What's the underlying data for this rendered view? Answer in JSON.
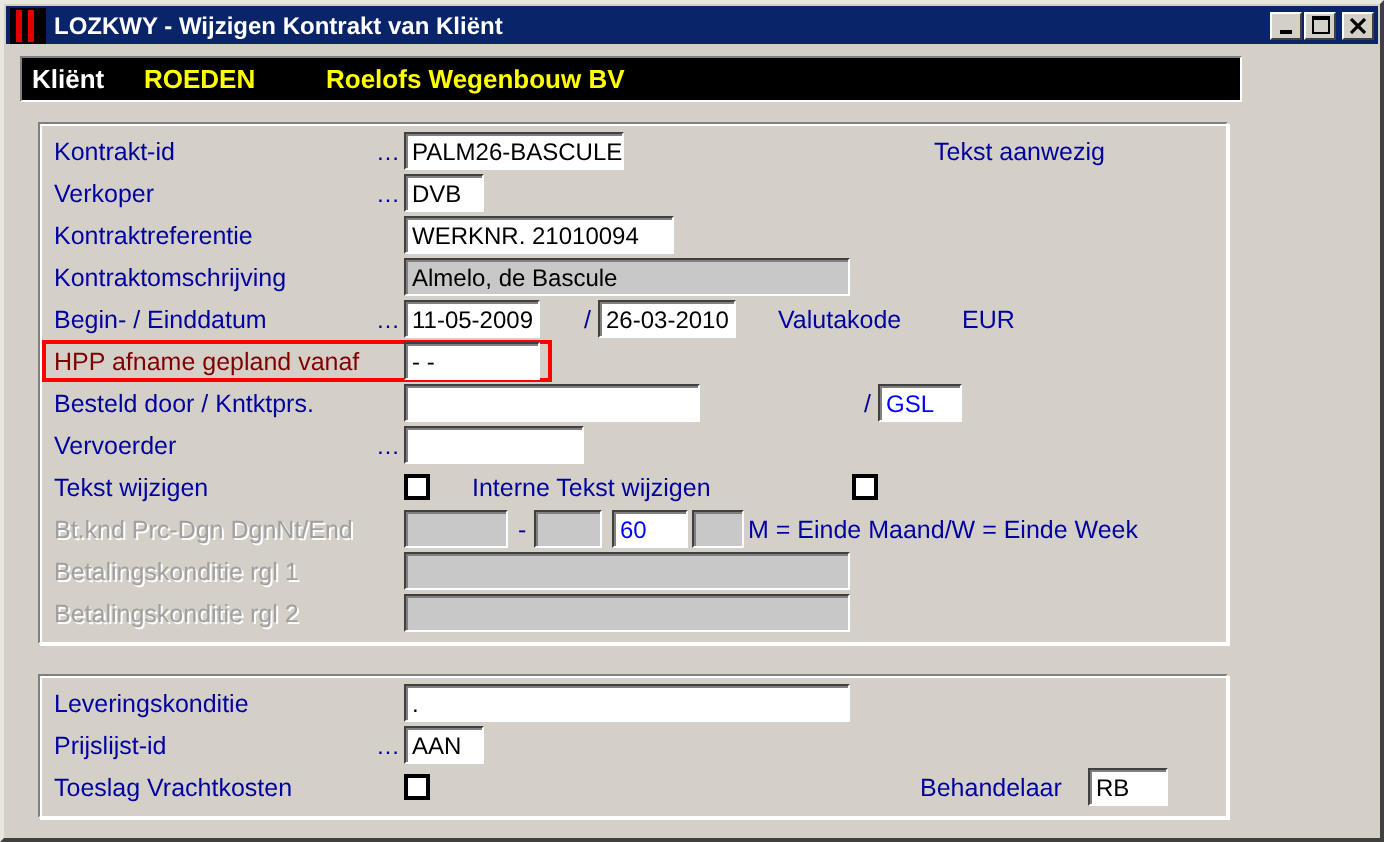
{
  "window": {
    "title": "LOZKWY - Wijzigen Kontrakt van Kliënt"
  },
  "client": {
    "label": "Kliënt",
    "code": "ROEDEN",
    "name": "Roelofs Wegenbouw BV"
  },
  "sections": [
    {
      "rows": [
        {
          "label": "Kontrakt-id",
          "lookup": "…",
          "disabled": false,
          "highlighted": false,
          "items": [
            {
              "kind": "field",
              "value": "PALM26-BASCULE",
              "disabled": false
            },
            {
              "kind": "text",
              "text": "Tekst aanwezig"
            }
          ]
        },
        {
          "label": "Verkoper",
          "lookup": "…",
          "disabled": false,
          "highlighted": false,
          "items": [
            {
              "kind": "field",
              "value": "DVB",
              "disabled": false
            }
          ]
        },
        {
          "label": "Kontraktreferentie",
          "disabled": false,
          "highlighted": false,
          "items": [
            {
              "kind": "field",
              "value": "WERKNR. 21010094",
              "disabled": false
            }
          ]
        },
        {
          "label": "Kontraktomschrijving",
          "disabled": false,
          "highlighted": false,
          "items": [
            {
              "kind": "field",
              "value": "Almelo, de Bascule",
              "disabled": true
            }
          ]
        },
        {
          "label": "Begin- / Einddatum",
          "lookup": "…",
          "disabled": false,
          "highlighted": false,
          "items": [
            {
              "kind": "field",
              "value": "11-05-2009",
              "disabled": false
            },
            {
              "kind": "text",
              "text": "/"
            },
            {
              "kind": "field",
              "value": "26-03-2010",
              "disabled": false
            },
            {
              "kind": "text",
              "text": "Valutakode"
            },
            {
              "kind": "text",
              "text": "EUR"
            }
          ]
        },
        {
          "label": "HPP afname gepland vanaf",
          "disabled": false,
          "highlighted": true,
          "items": [
            {
              "kind": "field",
              "value": " - -",
              "disabled": false
            }
          ]
        },
        {
          "label": "Besteld door / Kntktprs.",
          "disabled": false,
          "highlighted": false,
          "items": [
            {
              "kind": "field",
              "value": "",
              "disabled": false
            },
            {
              "kind": "text",
              "text": "/"
            },
            {
              "kind": "field",
              "value": "GSL",
              "disabled": false,
              "color": "#0000ff"
            }
          ]
        },
        {
          "label": "Vervoerder",
          "lookup": "…",
          "disabled": false,
          "highlighted": false,
          "items": [
            {
              "kind": "field",
              "value": "",
              "disabled": false
            }
          ]
        },
        {
          "label": "Tekst wijzigen",
          "disabled": false,
          "highlighted": false,
          "items": [
            {
              "kind": "checkbox",
              "checked": false
            },
            {
              "kind": "text",
              "text": "Interne Tekst wijzigen"
            },
            {
              "kind": "checkbox",
              "checked": false
            }
          ]
        },
        {
          "label": "Bt.knd Prc-Dgn DgnNt/End",
          "disabled": true,
          "highlighted": false,
          "items": [
            {
              "kind": "field",
              "value": "",
              "disabled": true
            },
            {
              "kind": "text",
              "text": "-"
            },
            {
              "kind": "field",
              "value": "",
              "disabled": true
            },
            {
              "kind": "field",
              "value": "60",
              "disabled": false,
              "color": "#0000ff"
            },
            {
              "kind": "field",
              "value": "",
              "disabled": true
            },
            {
              "kind": "text",
              "text": "M = Einde Maand/W = Einde Week"
            }
          ]
        },
        {
          "label": "Betalingskonditie rgl 1",
          "disabled": true,
          "highlighted": false,
          "items": [
            {
              "kind": "field",
              "value": "",
              "disabled": true
            }
          ]
        },
        {
          "label": "Betalingskonditie rgl 2",
          "disabled": true,
          "highlighted": false,
          "items": [
            {
              "kind": "field",
              "value": "",
              "disabled": true
            }
          ]
        }
      ]
    },
    {
      "rows": [
        {
          "label": "Leveringskonditie",
          "disabled": false,
          "highlighted": false,
          "items": [
            {
              "kind": "field",
              "value": ".",
              "disabled": false
            }
          ]
        },
        {
          "label": "Prijslijst-id",
          "lookup": "…",
          "disabled": false,
          "highlighted": false,
          "items": [
            {
              "kind": "field",
              "value": "AAN",
              "disabled": false
            }
          ]
        },
        {
          "label": "Toeslag Vrachtkosten",
          "disabled": false,
          "highlighted": false,
          "items": [
            {
              "kind": "checkbox",
              "checked": false
            },
            {
              "kind": "text",
              "text": "Behandelaar"
            },
            {
              "kind": "field",
              "value": "RB",
              "disabled": false
            }
          ]
        }
      ]
    }
  ]
}
